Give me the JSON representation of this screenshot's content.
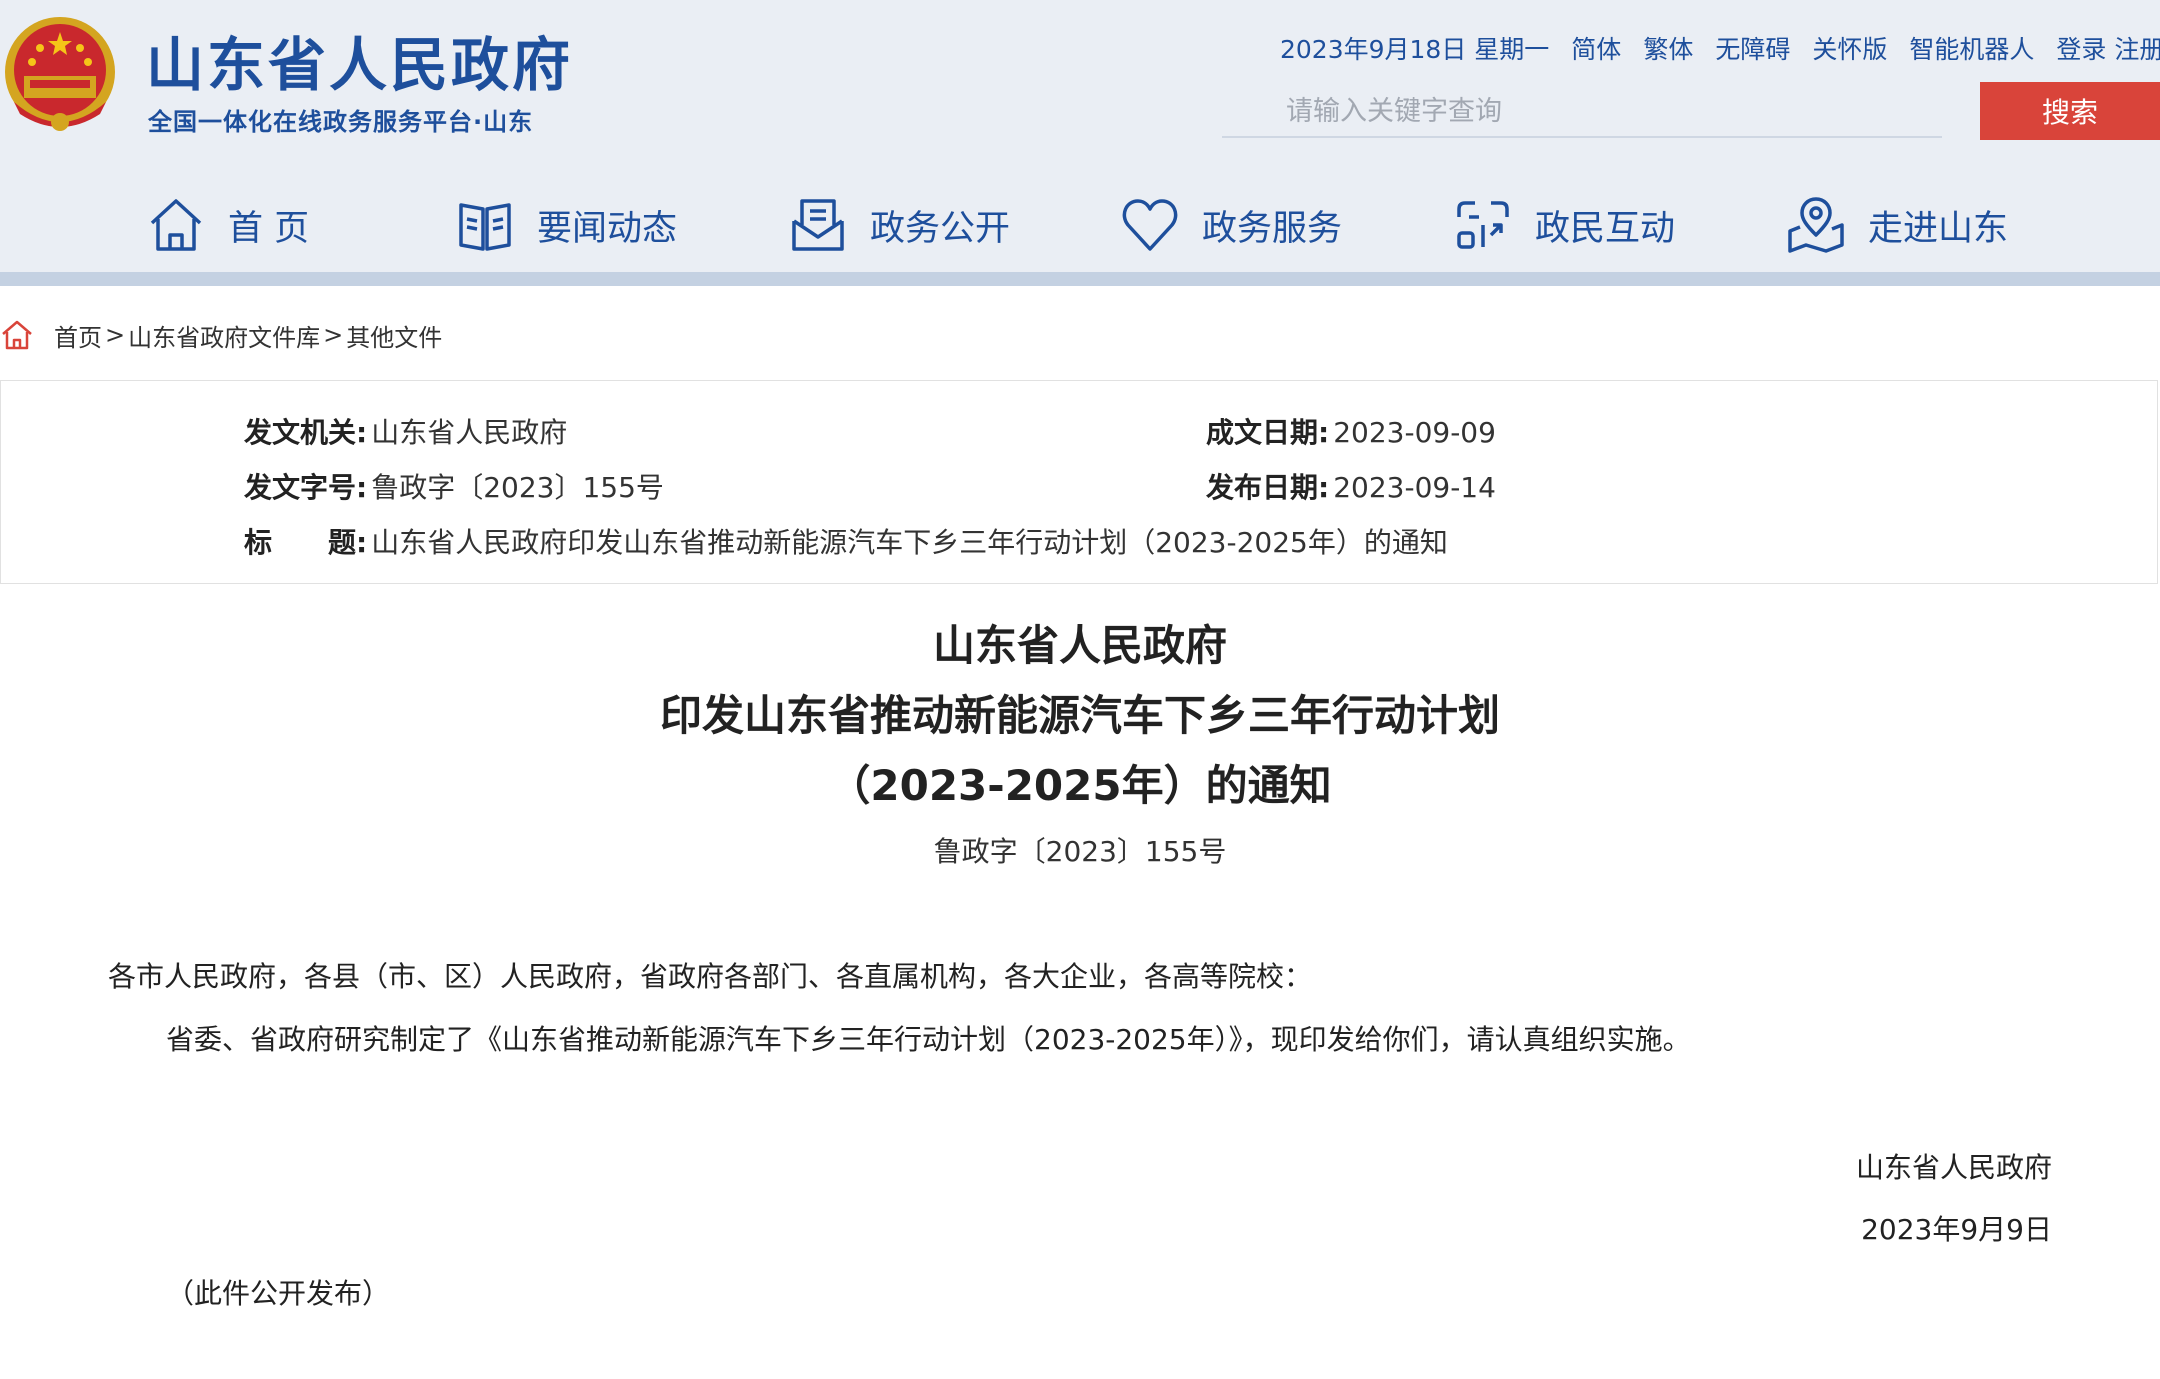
{
  "header": {
    "site_title": "山东省人民政府",
    "site_subtitle": "全国一体化在线政务服务平台·山东",
    "top_links": [
      "2023年9月18日 星期一",
      "简体",
      "繁体",
      "无障碍",
      "关怀版",
      "智能机器人",
      "登录",
      "注册"
    ],
    "search": {
      "placeholder": "请输入关键字查询",
      "button": "搜索"
    },
    "accent": "#1e4f9c",
    "search_button_color": "#d9443a"
  },
  "nav": [
    {
      "label": "首 页",
      "icon": "home-icon"
    },
    {
      "label": "要闻动态",
      "icon": "book-icon"
    },
    {
      "label": "政务公开",
      "icon": "envelope-icon"
    },
    {
      "label": "政务服务",
      "icon": "heart-icon"
    },
    {
      "label": "政民互动",
      "icon": "interact-icon"
    },
    {
      "label": "走进山东",
      "icon": "map-pin-icon"
    }
  ],
  "breadcrumb": [
    "首页",
    "山东省政府文件库",
    "其他文件"
  ],
  "meta": {
    "issuer_label": "发文机关:",
    "issuer": "山东省人民政府",
    "doc_no_label": "发文字号:",
    "doc_no": "鲁政字〔2023〕155号",
    "title_label": "标　　题:",
    "title": "山东省人民政府印发山东省推动新能源汽车下乡三年行动计划（2023-2025年）的通知",
    "written_date_label": "成文日期:",
    "written_date": "2023-09-09",
    "publish_date_label": "发布日期:",
    "publish_date": "2023-09-14"
  },
  "document": {
    "title_lines": [
      "山东省人民政府",
      "印发山东省推动新能源汽车下乡三年行动计划",
      "（2023-2025年）的通知"
    ],
    "number": "鲁政字〔2023〕155号",
    "addressee": "各市人民政府，各县（市、区）人民政府，省政府各部门、各直属机构，各大企业，各高等院校：",
    "body": "省委、省政府研究制定了《山东省推动新能源汽车下乡三年行动计划（2023-2025年）》，现印发给你们，请认真组织实施。",
    "signature": "山东省人民政府",
    "signature_date": "2023年9月9日",
    "note": "（此件公开发布）"
  }
}
